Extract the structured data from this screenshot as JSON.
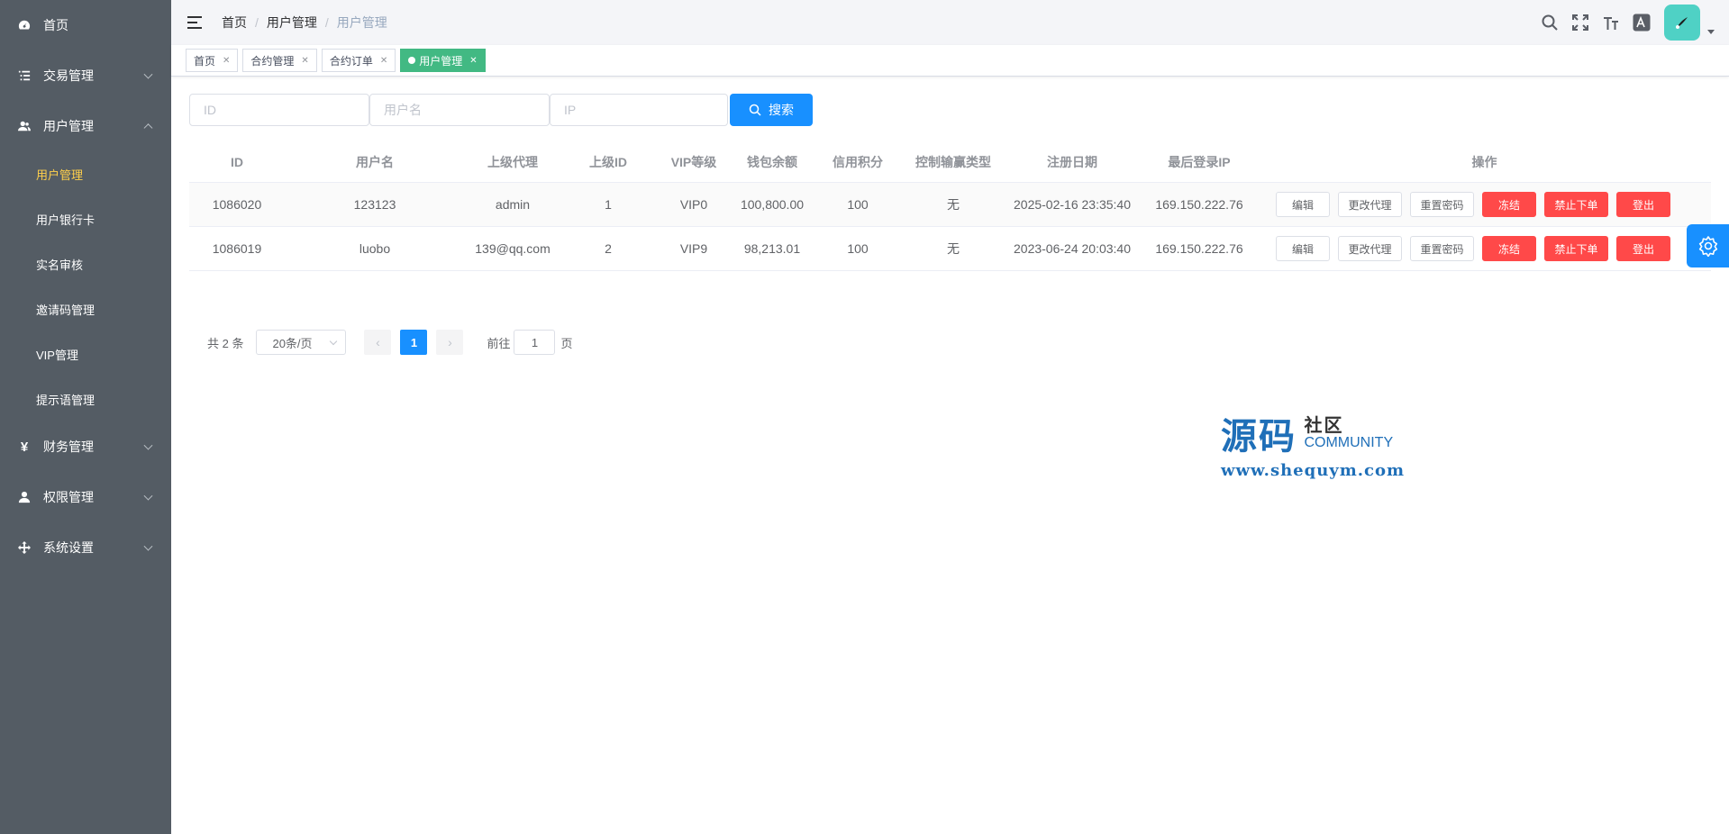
{
  "sidebar": {
    "items": [
      {
        "label": "首页",
        "icon": "dashboard-icon"
      },
      {
        "label": "交易管理",
        "icon": "list-icon"
      },
      {
        "label": "用户管理",
        "icon": "users-icon"
      },
      {
        "label": "财务管理",
        "icon": "yen-icon"
      },
      {
        "label": "权限管理",
        "icon": "user-icon"
      },
      {
        "label": "系统设置",
        "icon": "cross-arrows-icon"
      }
    ],
    "sub_items": [
      {
        "label": "用户管理",
        "active": true
      },
      {
        "label": "用户银行卡"
      },
      {
        "label": "实名审核"
      },
      {
        "label": "邀请码管理"
      },
      {
        "label": "VIP管理"
      },
      {
        "label": "提示语管理"
      }
    ]
  },
  "header": {
    "breadcrumb": [
      "首页",
      "用户管理",
      "用户管理"
    ]
  },
  "tags": [
    "首页",
    "合约管理",
    "合约订单",
    "用户管理"
  ],
  "search": {
    "id_placeholder": "ID",
    "username_placeholder": "用户名",
    "ip_placeholder": "IP",
    "button": "搜索"
  },
  "table": {
    "headers": [
      "ID",
      "用户名",
      "上级代理",
      "上级ID",
      "VIP等级",
      "钱包余额",
      "信用积分",
      "控制输赢类型",
      "注册日期",
      "最后登录IP",
      "操作"
    ],
    "rows": [
      [
        "1086020",
        "123123",
        "admin",
        "1",
        "VIP0",
        "100,800.00",
        "100",
        "无",
        "2025-02-16 23:35:40",
        "169.150.222.76"
      ],
      [
        "1086019",
        "luobo",
        "139@qq.com",
        "2",
        "VIP9",
        "98,213.01",
        "100",
        "无",
        "2023-06-24 20:03:40",
        "169.150.222.76"
      ]
    ],
    "actions": [
      "编辑",
      "更改代理",
      "重置密码",
      "冻结",
      "禁止下单",
      "登出"
    ]
  },
  "pagination": {
    "total": "共 2 条",
    "page_size": "20条/页",
    "current": "1",
    "goto_label": "前往",
    "goto_value": "1",
    "page_suffix": "页"
  },
  "watermark": {
    "cn": "源码",
    "cn2": "社区",
    "en": "COMMUNITY",
    "url": "www.shequym.com"
  },
  "colors": {
    "sidebar_bg": "#545c64",
    "active_menu": "#ffd04b",
    "primary": "#1890ff",
    "danger": "#ff4949",
    "tag_active": "#42b983"
  }
}
